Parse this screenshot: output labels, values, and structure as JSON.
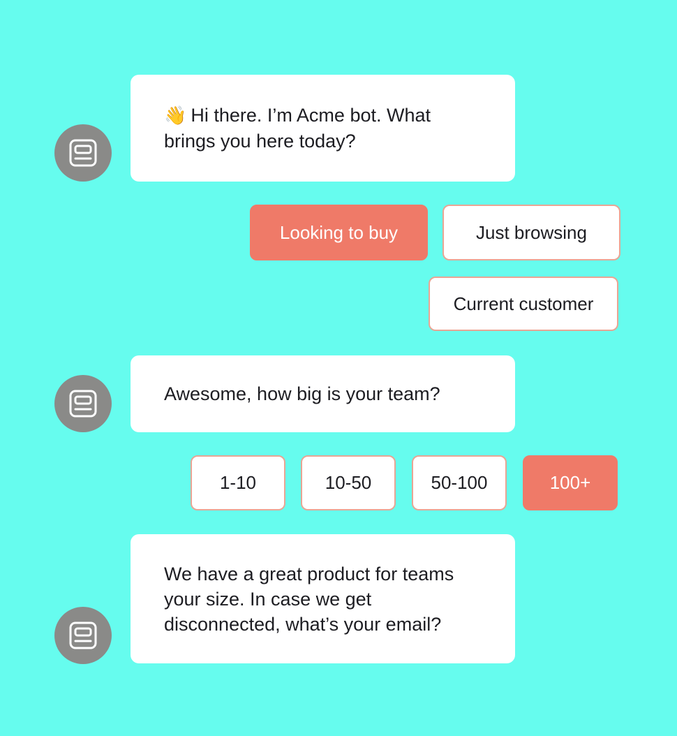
{
  "colors": {
    "background": "#66fcee",
    "bubble": "#ffffff",
    "avatar": "#8a8a88",
    "accent": "#ef7a68",
    "chip_border": "#e8a594"
  },
  "bot": {
    "avatar_icon": "bot-icon",
    "greeting_emoji": "👋",
    "messages": [
      "Hi there. I’m Acme bot. What brings you here today?",
      "Awesome, how big is your team?",
      "We have a great product for teams your size. In case we get disconnected, what’s your email?"
    ]
  },
  "intent_options": [
    {
      "label": "Looking to buy",
      "selected": true
    },
    {
      "label": "Just browsing",
      "selected": false
    },
    {
      "label": "Current customer",
      "selected": false
    }
  ],
  "team_size_options": [
    {
      "label": "1-10",
      "selected": false
    },
    {
      "label": "10-50",
      "selected": false
    },
    {
      "label": "50-100",
      "selected": false
    },
    {
      "label": "100+",
      "selected": true
    }
  ]
}
